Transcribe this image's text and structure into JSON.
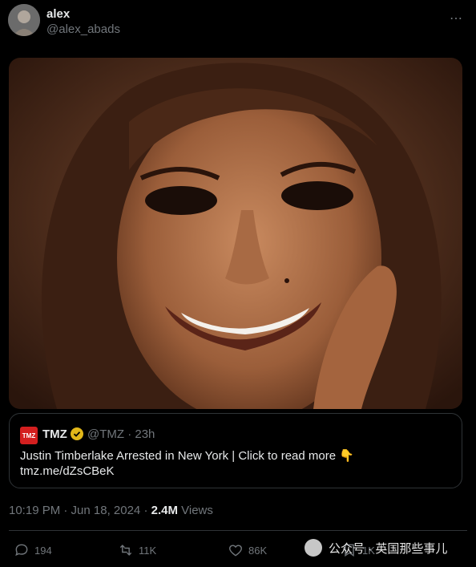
{
  "author": {
    "name": "alex",
    "handle": "@alex_abads"
  },
  "more_icon": "more-horizontal-icon",
  "quote": {
    "source_name": "TMZ",
    "logo_text": "TMZ",
    "handle_time": "@TMZ · 23h",
    "text": "Justin Timberlake Arrested in New York  |  Click to read more 👇",
    "link": "tmz.me/dZsCBeK",
    "badge_color": "#e2b719",
    "logo_color": "#d41f1f"
  },
  "meta": {
    "time_date": "10:19 PM · Jun 18, 2024 · ",
    "views_count": "2.4M",
    "views_label": " Views"
  },
  "actions": {
    "replies": "194",
    "reposts": "11K",
    "likes": "86K",
    "bookmarks": "1K"
  },
  "watermark": {
    "text": "公众号 · 英国那些事儿"
  },
  "photo": {
    "subject": "smiling-woman-portrait"
  }
}
